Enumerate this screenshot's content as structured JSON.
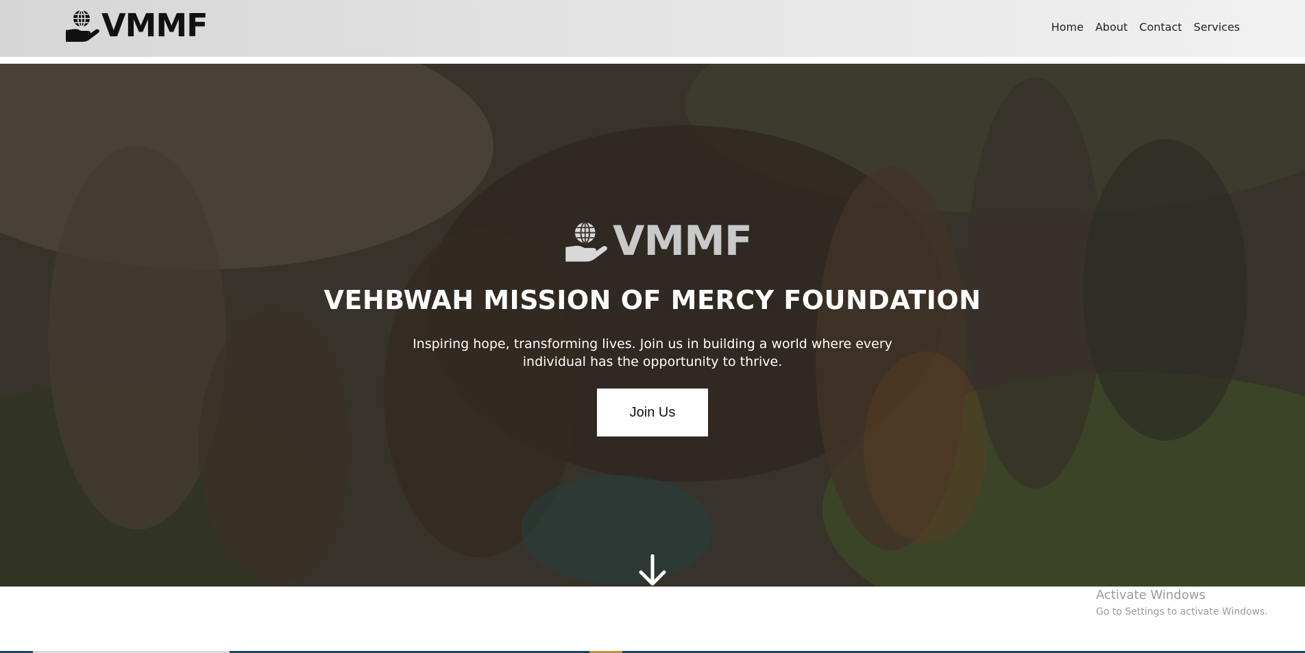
{
  "header": {
    "logo_text": "VMMF",
    "nav": [
      "Home",
      "About",
      "Contact",
      "Services"
    ]
  },
  "hero": {
    "logo_text": "VMMF",
    "title": "VEHBWAH MISSION OF MERCY FOUNDATION",
    "subtitle": "Inspiring hope, transforming lives. Join us in building a world where every individual has the opportunity to thrive.",
    "cta_label": "Join Us",
    "scroll_icon": "arrow-down-icon"
  },
  "watermark": {
    "title": "Activate Windows",
    "subtitle": "Go to Settings to activate Windows."
  },
  "colors": {
    "header_bg": "#e3e3e3",
    "logo_text": "#111111",
    "hero_logo_text": "#c9c9c9",
    "cta_bg": "#ffffff",
    "bottom_strip": "#1d4760"
  }
}
